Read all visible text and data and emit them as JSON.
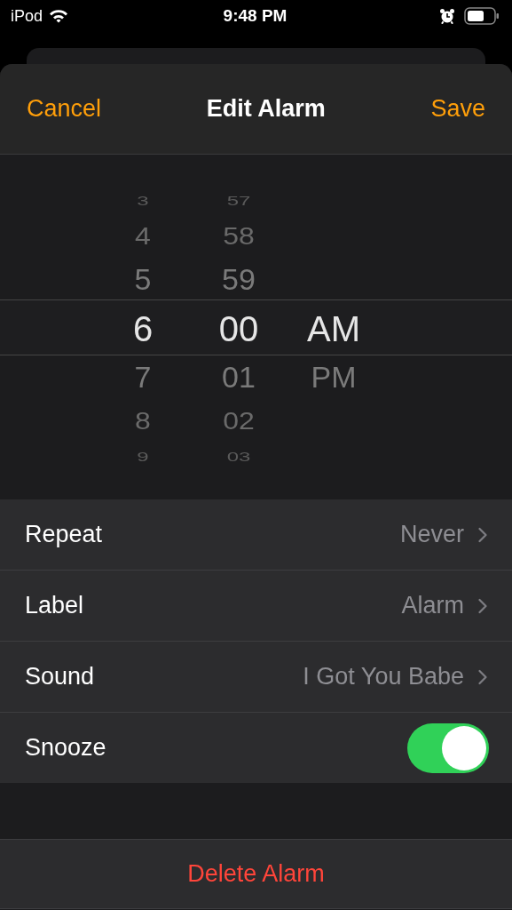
{
  "status_bar": {
    "carrier": "iPod",
    "time": "9:48 PM"
  },
  "nav": {
    "cancel": "Cancel",
    "title": "Edit Alarm",
    "save": "Save"
  },
  "picker": {
    "columns": [
      {
        "items": [
          {
            "label": "3",
            "selected": false
          },
          {
            "label": "4",
            "selected": false
          },
          {
            "label": "5",
            "selected": false
          },
          {
            "label": "6",
            "selected": true
          },
          {
            "label": "7",
            "selected": false
          },
          {
            "label": "8",
            "selected": false
          },
          {
            "label": "9",
            "selected": false
          }
        ]
      },
      {
        "items": [
          {
            "label": "57",
            "selected": false
          },
          {
            "label": "58",
            "selected": false
          },
          {
            "label": "59",
            "selected": false
          },
          {
            "label": "00",
            "selected": true
          },
          {
            "label": "01",
            "selected": false
          },
          {
            "label": "02",
            "selected": false
          },
          {
            "label": "03",
            "selected": false
          }
        ]
      },
      {
        "items": [
          {
            "label": "AM",
            "selected": true
          },
          {
            "label": "PM",
            "selected": false
          }
        ]
      }
    ]
  },
  "settings": [
    {
      "kind": "disclosure",
      "label": "Repeat",
      "value": "Never"
    },
    {
      "kind": "disclosure",
      "label": "Label",
      "value": "Alarm"
    },
    {
      "kind": "disclosure",
      "label": "Sound",
      "value": "I Got You Babe"
    },
    {
      "kind": "toggle",
      "label": "Snooze",
      "on": true
    }
  ],
  "delete": "Delete Alarm"
}
